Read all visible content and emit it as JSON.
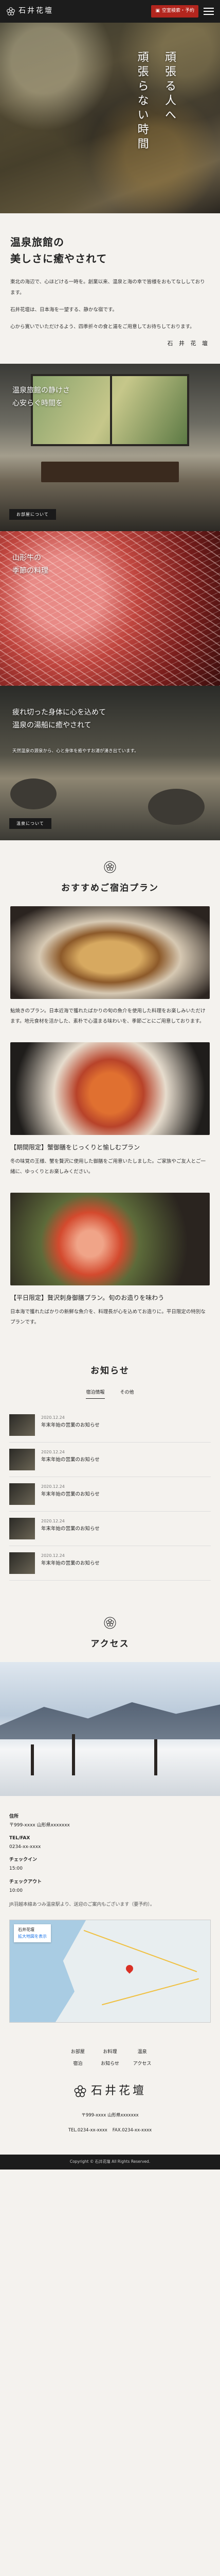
{
  "header": {
    "logo_text": "石井花壇",
    "reserve_label": "空室検索・予約"
  },
  "hero": {
    "line1": "頑張る人へ",
    "line2": "頑張らない時間"
  },
  "intro": {
    "title_l1": "温泉旅館の",
    "title_l2": "美しさに癒やされて",
    "p1": "東北の海辺で、心ほどける一時を。創業以来、温泉と海の幸で皆様をおもてなししております。",
    "p2": "石井花壇は、日本海を一望する、静かな宿です。",
    "p3": "心から寛いでいただけるよう、四季折々の食と湯をご用意してお待ちしております。",
    "sign": "石 井 花 壇"
  },
  "features": [
    {
      "title_l1": "温泉旅館の静けさ",
      "title_l2": "心安らぐ時間を",
      "button": "お部屋について"
    },
    {
      "title_l1": "山形牛の",
      "title_l2": "季節の料理",
      "button": ""
    },
    {
      "title_l1": "疲れ切った身体に心を込めて",
      "title_l2": "温泉の湯船に癒やされて",
      "body": "天然温泉の源泉から、心と身体を癒やすお湯が湧き出ています。",
      "button": "温泉について"
    }
  ],
  "plans": {
    "title": "おすすめご宿泊プラン",
    "items": [
      {
        "title": "",
        "text": "鮎焼きのプラン。日本近海で獲れたばかりの旬の魚介を使用した料理をお楽しみいただけます。地元食材を活かした、素朴で心温まる味わいを、季節ごとにご用意しております。"
      },
      {
        "title": "【期間限定】蟹御膳をじっくりと愉しむプラン",
        "text": "冬の味覚の王様、蟹を贅沢に使用した御膳をご用意いたしました。ご家族やご友人とご一緒に、ゆっくりとお楽しみください。"
      },
      {
        "title": "【平日限定】贅沢刺身御膳プラン。旬のお造りを味わう",
        "text": "日本海で獲れたばかりの新鮮な魚介を、料理長が心を込めてお造りに。平日限定の特別なプランです。"
      }
    ]
  },
  "news": {
    "title": "お知らせ",
    "tabs": [
      "宿泊情報",
      "その他"
    ],
    "items": [
      {
        "date": "2020.12.24",
        "title": "年末年始の営業のお知らせ"
      },
      {
        "date": "2020.12.24",
        "title": "年末年始の営業のお知らせ"
      },
      {
        "date": "2020.12.24",
        "title": "年末年始の営業のお知らせ"
      },
      {
        "date": "2020.12.24",
        "title": "年末年始の営業のお知らせ"
      },
      {
        "date": "2020.12.24",
        "title": "年末年始の営業のお知らせ"
      }
    ]
  },
  "access": {
    "title": "アクセス",
    "address_label": "住所",
    "address": "〒999-xxxx 山形県xxxxxxx",
    "tel_label": "TEL/FAX",
    "tel": "0234-xx-xxxx",
    "checkin_label": "チェックイン",
    "checkin": "15:00",
    "checkout_label": "チェックアウト",
    "checkout": "10:00",
    "note": "JR羽越本線あつみ温泉駅より、送迎のご案内もございます（要予約）。",
    "map_place": "石井花壇",
    "map_link": "拡大地図を表示"
  },
  "footer": {
    "nav": [
      "お部屋",
      "お料理",
      "温泉",
      "宿泊",
      "お知らせ",
      "アクセス"
    ],
    "logo_text": "石井花壇",
    "address": "〒999-xxxx 山形県xxxxxxx",
    "tel": "TEL.0234-xx-xxxx",
    "fax": "FAX.0234-xx-xxxx",
    "copyright": "Copyright © 石井花壇 All Rights Reserved."
  },
  "colors": {
    "accent": "#b3261e",
    "header_bg": "#1c1c1c",
    "page_bg": "#f4f2ee"
  }
}
